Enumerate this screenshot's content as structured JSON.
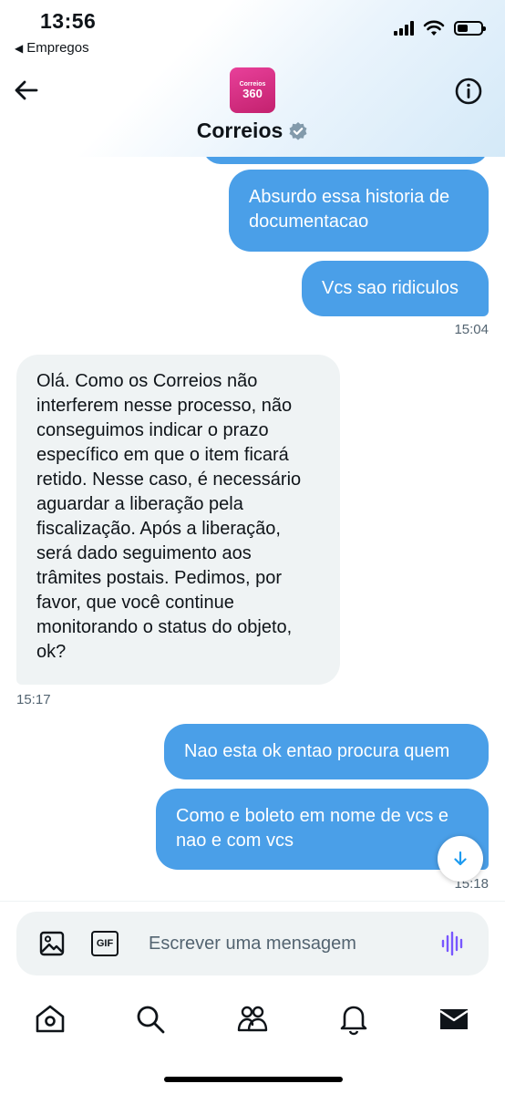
{
  "status_bar": {
    "time": "13:56",
    "back_app": "Empregos"
  },
  "header": {
    "title": "Correios",
    "avatar_small": "Correios",
    "avatar_big": "360"
  },
  "messages": [
    {
      "direction": "outgoing",
      "text": "Absurdo essa historia de documentacao"
    },
    {
      "direction": "outgoing",
      "text": "Vcs sao ridiculos",
      "time": "15:04"
    },
    {
      "direction": "incoming",
      "text": "Olá. Como os Correios não interferem nesse processo, não conseguimos indicar o prazo específico em que o item ficará retido. Nesse caso, é necessário aguardar a liberação pela fiscalização. Após a liberação, será dado seguimento aos trâmites postais. Pedimos, por favor, que você continue monitorando o status do objeto, ok?",
      "time": "15:17"
    },
    {
      "direction": "outgoing",
      "text": "Nao esta ok entao procura quem"
    },
    {
      "direction": "outgoing",
      "text": "Como e boleto em nome de vcs e nao e com vcs",
      "time": "15:18"
    }
  ],
  "composer": {
    "placeholder": "Escrever uma mensagem",
    "gif_label": "GIF"
  },
  "icons": {
    "back": "arrow-left-icon",
    "info": "info-icon",
    "verified": "verified-badge-icon",
    "image": "image-icon",
    "gif": "gif-icon",
    "voice": "voice-wave-icon",
    "scroll": "arrow-down-icon",
    "nav": [
      "home-icon",
      "search-icon",
      "communities-icon",
      "bell-icon",
      "mail-icon"
    ]
  },
  "colors": {
    "outgoing_bubble": "#4a9fe8",
    "incoming_bubble": "#eff3f4",
    "voice_accent": "#7856ff"
  }
}
